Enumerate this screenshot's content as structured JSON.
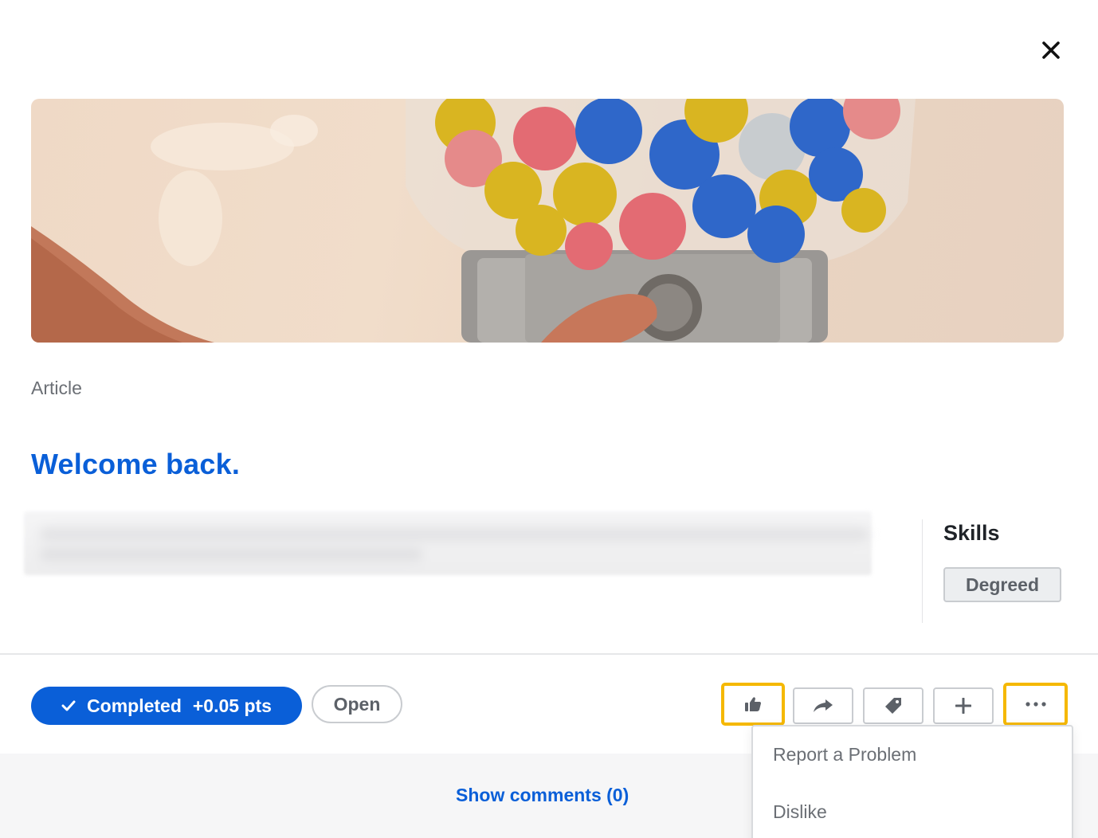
{
  "dialog": {
    "close_label": "Close"
  },
  "hero": {
    "image_icon": "gumball-machine-brains-image"
  },
  "content": {
    "type_label": "Article",
    "title": "Welcome back."
  },
  "skills": {
    "heading": "Skills",
    "tags": [
      "Degreed"
    ]
  },
  "actions": {
    "completed_label": "Completed",
    "points_label": "+0.05 pts",
    "open_label": "Open",
    "icons": [
      "thumbs-up-icon",
      "share-icon",
      "tag-icon",
      "plus-icon",
      "more-icon"
    ]
  },
  "comments": {
    "show_label": "Show comments (0)"
  },
  "more_menu": {
    "items": [
      "Report a Problem",
      "Dislike"
    ]
  },
  "colors": {
    "primary": "#0a5fd8",
    "highlight": "#f5b800",
    "muted_text": "#6b6f75"
  }
}
